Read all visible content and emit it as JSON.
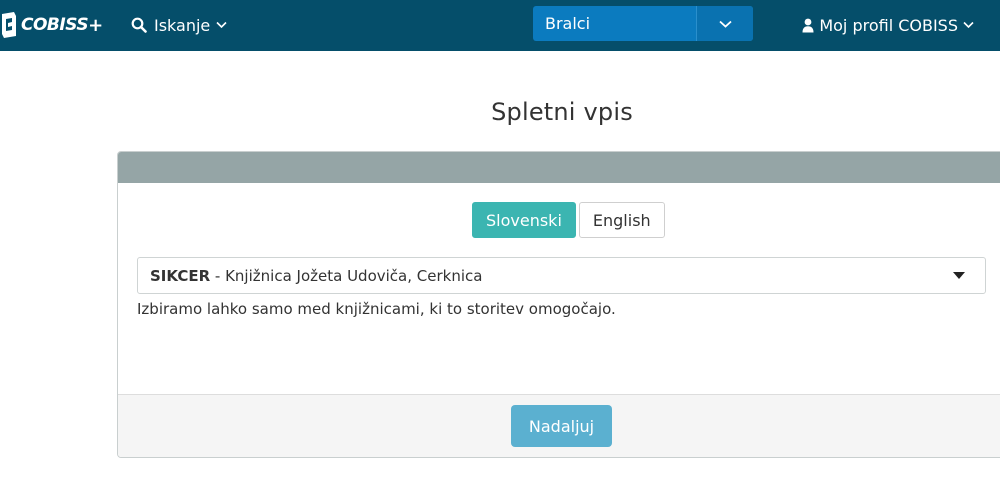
{
  "navbar": {
    "logo_text": "COBISS",
    "logo_plus": "+",
    "search_label": "Iskanje",
    "role_select_value": "Bralci",
    "profile_label": "Moj profil COBISS"
  },
  "page": {
    "title": "Spletni vpis"
  },
  "panel": {
    "languages": [
      "Slovenski",
      "English"
    ],
    "active_language": "Slovenski",
    "library": {
      "code": "SIKCER",
      "separator": " - ",
      "name": "Knjižnica Jožeta Udoviča, Cerknica"
    },
    "hint": "Izbiramo lahko samo med knjižnicami, ki to storitev omogočajo.",
    "continue_label": "Nadaljuj"
  },
  "colors": {
    "navbar_bg": "#054e6a",
    "role_select_bg": "#0b7bbf",
    "panel_header": "#95a5a6",
    "active_language": "#3bb5b1",
    "continue_button": "#5bb0d0"
  },
  "icons": {
    "logo": "cobiss-logo-icon",
    "search": "search-icon",
    "chevron": "chevron-down-icon",
    "user": "user-icon",
    "dropdown": "caret-down-icon"
  }
}
